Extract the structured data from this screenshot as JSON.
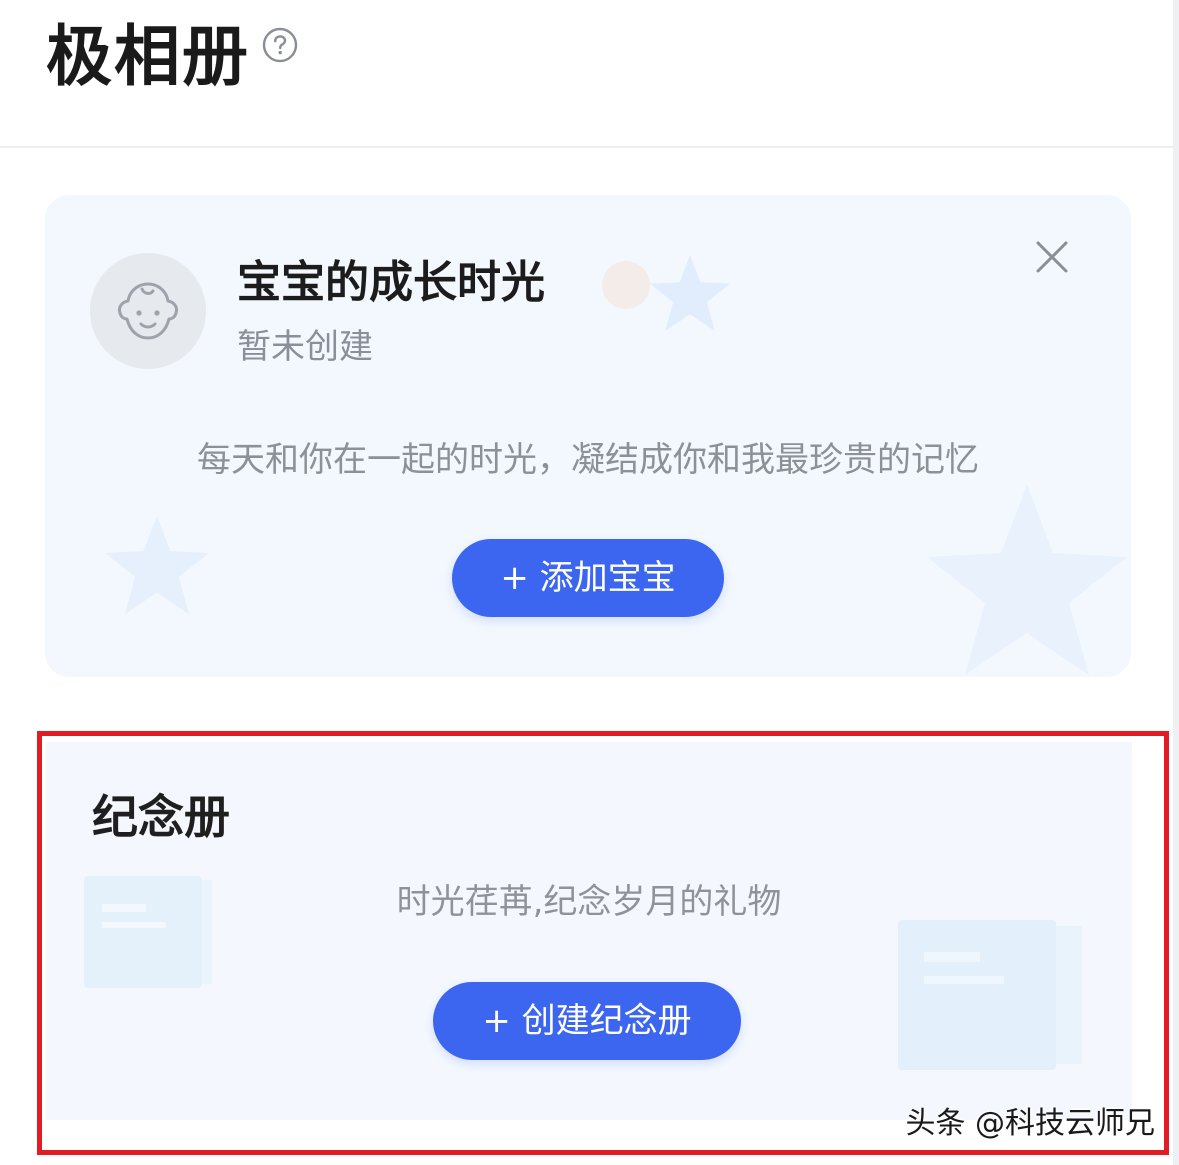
{
  "header": {
    "title": "极相册",
    "help_icon": "question-circle-icon"
  },
  "baby_card": {
    "title": "宝宝的成长时光",
    "status": "暂未创建",
    "description": "每天和你在一起的时光，凝结成你和我最珍贵的记忆",
    "add_button_label": "+ 添加宝宝",
    "avatar_icon": "baby-face-icon",
    "close_icon": "close-icon"
  },
  "album_section": {
    "title": "纪念册",
    "description": "时光荏苒,纪念岁月的礼物",
    "create_button_label": "+ 创建纪念册"
  },
  "watermark": "头条 @科技云师兄",
  "colors": {
    "accent": "#3c66f0",
    "highlight": "#e31b23",
    "card_bg": "#f3f8fe"
  }
}
